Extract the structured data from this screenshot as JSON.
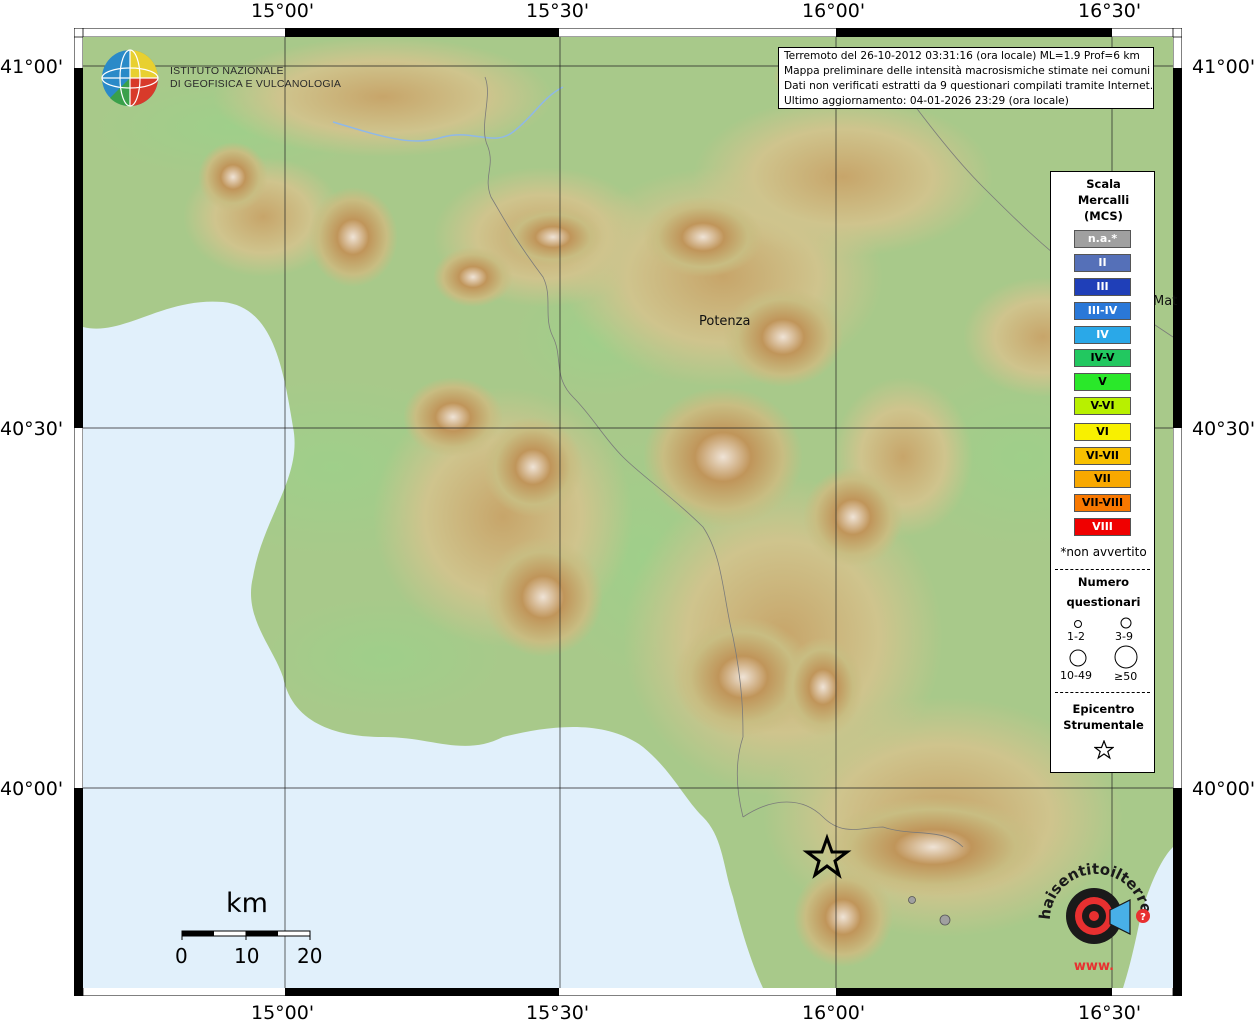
{
  "axes": {
    "top_lon": [
      "15°00'",
      "15°30'",
      "16°00'",
      "16°30'"
    ],
    "bottom_lon": [
      "15°00'",
      "15°30'",
      "16°00'",
      "16°30'"
    ],
    "left_lat": [
      "41°00'",
      "40°30'",
      "40°00'"
    ],
    "right_lat": [
      "41°00'",
      "40°30'",
      "40°00'"
    ]
  },
  "logo": {
    "line1": "ISTITUTO NAZIONALE",
    "line2": "DI GEOFISICA E VULCANOLOGIA"
  },
  "info": {
    "line1": "Terremoto del 26-10-2012 03:31:16 (ora locale) ML=1.9 Prof=6 km",
    "line2": "Mappa preliminare delle intensità macrosismiche stimate nei comuni",
    "line3": "Dati non verificati estratti da 9 questionari compilati tramite Internet.",
    "line4": "Ultimo aggiornamento: 04-01-2026 23:29 (ora locale)"
  },
  "places": {
    "potenza": "Potenza",
    "matera_partial": "Mat"
  },
  "legend": {
    "title1": "Scala",
    "title2": "Mercalli",
    "title3": "(MCS)",
    "levels": [
      {
        "label": "n.a.*",
        "color": "#a0a0a0"
      },
      {
        "label": "II",
        "color": "#5570b8"
      },
      {
        "label": "III",
        "color": "#1f3fb8"
      },
      {
        "label": "III-IV",
        "color": "#2a78d8"
      },
      {
        "label": "IV",
        "color": "#2aa8e8"
      },
      {
        "label": "IV-V",
        "color": "#22c860"
      },
      {
        "label": "V",
        "color": "#2ae82a"
      },
      {
        "label": "V-VI",
        "color": "#b8f000"
      },
      {
        "label": "VI",
        "color": "#f8f000"
      },
      {
        "label": "VI-VII",
        "color": "#f8c000"
      },
      {
        "label": "VII",
        "color": "#f8a800"
      },
      {
        "label": "VII-VIII",
        "color": "#f87800"
      },
      {
        "label": "VIII",
        "color": "#f00000"
      }
    ],
    "note": "*non avvertito",
    "count_title1": "Numero",
    "count_title2": "questionari",
    "count_labels": [
      "1-2",
      "3-9",
      "10-49",
      "≥50"
    ],
    "epi_title1": "Epicentro",
    "epi_title2": "Strumentale"
  },
  "scalebar": {
    "unit": "km",
    "ticks": [
      "0",
      "10",
      "20"
    ]
  },
  "badge": {
    "text": "haisentitoilterremoto.it",
    "www": "www."
  },
  "colors": {
    "sea": "#e1f0fb",
    "lowland": "#7fb86f",
    "hills": "#c9c58a",
    "mountains": "#b9935a",
    "peaks": "#e8dcd0"
  }
}
